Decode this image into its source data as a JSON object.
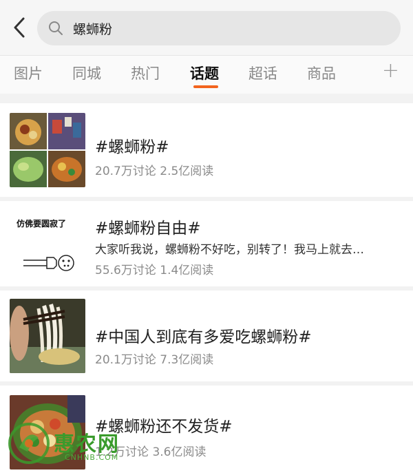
{
  "search": {
    "query": "螺蛳粉"
  },
  "tabs": [
    {
      "label": "图片"
    },
    {
      "label": "同城"
    },
    {
      "label": "热门"
    },
    {
      "label": "话题",
      "active": true
    },
    {
      "label": "超话"
    },
    {
      "label": "商品"
    }
  ],
  "tab_plus": "+",
  "colors": {
    "accent": "#f2641e",
    "watermark": "#3a9b2c"
  },
  "topics": [
    {
      "title": "#螺蛳粉#",
      "stats": "20.7万讨论 2.5亿阅读"
    },
    {
      "title": "#螺蛳粉自由#",
      "description": "大家听我说，螺蛳粉不好吃，别转了！我马上就去…",
      "stats": "55.6万讨论 1.4亿阅读",
      "thumb_caption": "仿佛要圆寂了"
    },
    {
      "title": "#中国人到底有多爱吃螺蛳粉#",
      "stats": "20.1万讨论 7.3亿阅读"
    },
    {
      "title": "#螺蛳粉还不发货#",
      "stats": "1.2万讨论 3.6亿阅读"
    }
  ],
  "watermark": {
    "brand": "惠农网",
    "domain": "CNHNB.COM"
  }
}
